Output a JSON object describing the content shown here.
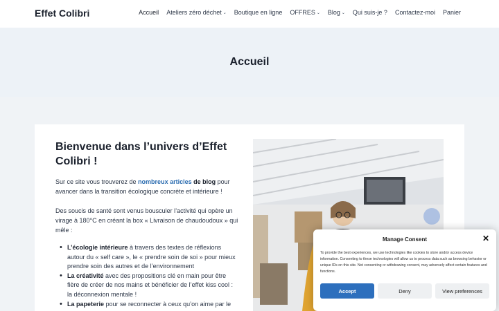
{
  "header": {
    "logo": "Effet Colibri",
    "nav": [
      {
        "label": "Accueil",
        "dropdown": false
      },
      {
        "label": "Ateliers zéro déchet",
        "dropdown": true
      },
      {
        "label": "Boutique en ligne",
        "dropdown": false
      },
      {
        "label": "OFFRES",
        "dropdown": true
      },
      {
        "label": "Blog",
        "dropdown": true
      },
      {
        "label": "Qui suis-je ?",
        "dropdown": false
      },
      {
        "label": "Contactez-moi",
        "dropdown": false
      },
      {
        "label": "Panier",
        "dropdown": false
      }
    ]
  },
  "hero": {
    "title": "Accueil"
  },
  "main": {
    "heading": "Bienvenue dans l’univers d’Effet Colibri !",
    "intro": {
      "prefix": "Sur ce site vous trouverez de ",
      "link": "nombreux articles",
      "bold": " de blog",
      "suffix": " pour avancer dans la transition écologique concrète et intérieure !"
    },
    "paragraph2": "Des soucis de santé sont venus bousculer l’activité qui opère un virage à 180°C en créant la box « Livraison de chaudoudoux » qui mêle :",
    "list": [
      {
        "bold": "L’écologie intérieure",
        "text": " à travers des textes de réflexions autour du « self care », le « prendre soin de soi » pour mieux prendre soin des autres et de l’environnement"
      },
      {
        "bold": "La créativité",
        "text": " avec des propositions clé en main pour être fière de créer de nos mains et bénéficier de l’effet kiss cool : la déconnexion mentale !"
      },
      {
        "bold": "La papeterie",
        "text": " pour se reconnecter à ceux qu’on aime par le"
      }
    ]
  },
  "consent": {
    "title": "Manage Consent",
    "text": "To provide the best experiences, we use technologies like cookies to store and/or access device information. Consenting to these technologies will allow us to process data such as browsing behavior or unique IDs on this site. Not consenting or withdrawing consent, may adversely affect certain features and functions.",
    "accept": "Accept",
    "deny": "Deny",
    "preferences": "View preferences",
    "close_icon": "close-icon"
  },
  "colors": {
    "accent": "#2d6fbd",
    "link": "#2b6cb0",
    "hero_bg": "#edf2f7",
    "page_bg": "#f0f3f6"
  }
}
